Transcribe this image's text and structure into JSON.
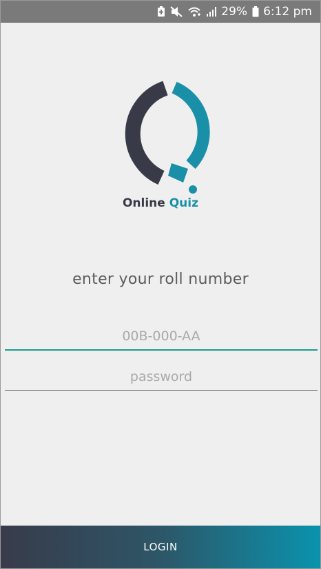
{
  "status_bar": {
    "battery_percent": "29%",
    "time": "6:12 pm",
    "icons": [
      "battery-saver-icon",
      "mute-icon",
      "wifi-icon",
      "signal-icon",
      "battery-icon"
    ]
  },
  "logo": {
    "name_part1": "Online",
    "name_part2": "Quiz",
    "colors": {
      "dark": "#383a48",
      "accent": "#1a8fa8"
    }
  },
  "form": {
    "prompt": "enter your roll number",
    "roll_placeholder": "00B-000-AA",
    "password_placeholder": "password",
    "underline_active_color": "#1b9c8e"
  },
  "login_button": {
    "label": "LOGIN"
  }
}
